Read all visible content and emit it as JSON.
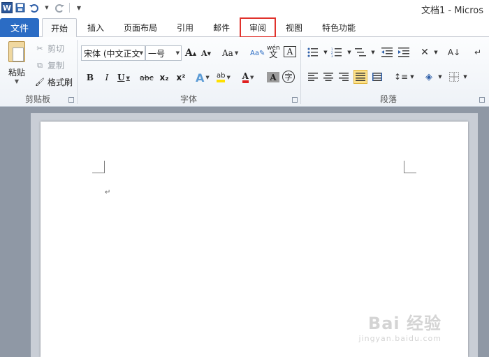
{
  "window": {
    "title": "文档1 - Micros"
  },
  "tabs": {
    "file": "文件",
    "items": [
      {
        "label": "开始",
        "active": true
      },
      {
        "label": "插入",
        "active": false
      },
      {
        "label": "页面布局",
        "active": false
      },
      {
        "label": "引用",
        "active": false
      },
      {
        "label": "邮件",
        "active": false
      },
      {
        "label": "审阅",
        "active": false,
        "highlighted": true
      },
      {
        "label": "视图",
        "active": false
      },
      {
        "label": "特色功能",
        "active": false
      }
    ]
  },
  "clipboard": {
    "paste": "粘贴",
    "cut": "剪切",
    "copy": "复制",
    "format_painter": "格式刷",
    "group_label": "剪贴板"
  },
  "font": {
    "font_name": "宋体 (中文正文",
    "font_size": "一号",
    "group_label": "字体",
    "buttons": {
      "grow": "A",
      "shrink": "A",
      "change_case": "Aa",
      "bold": "B",
      "italic": "I",
      "underline": "U",
      "strikethrough": "abc",
      "subscript": "x₂",
      "superscript": "x²",
      "font_color": "A",
      "char_shading": "A",
      "enclose": "字",
      "char_border": "A",
      "phonetic": "wén",
      "text_effects": "A",
      "highlight": "ab"
    },
    "colors": {
      "font_color": "#e02020",
      "highlight": "#ffe000"
    }
  },
  "paragraph": {
    "group_label": "段落"
  },
  "document": {
    "paragraph_mark": "↵"
  },
  "watermark": {
    "main": "Bai 经验",
    "sub": "jingyan.baidu.com"
  }
}
